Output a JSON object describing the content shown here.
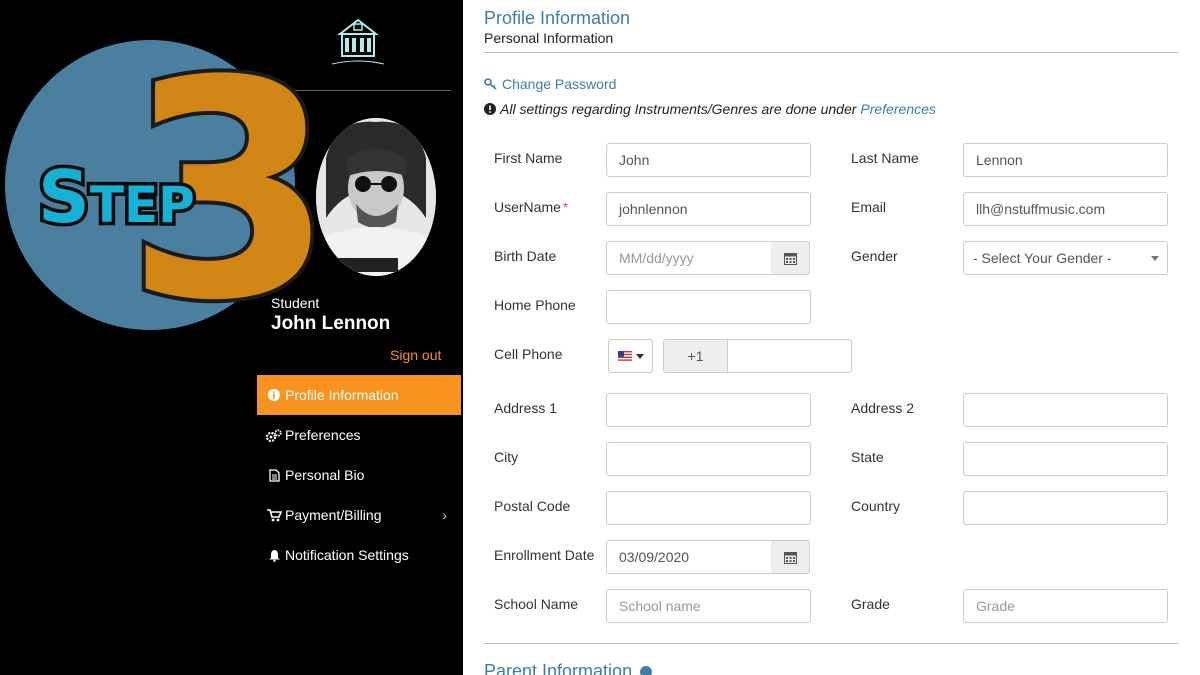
{
  "sidebar": {
    "role": "Student",
    "user_name": "John Lennon",
    "signout_label": "Sign out",
    "nav_items": [
      {
        "label": "Profile Information",
        "icon": "info-circle-icon",
        "active": true
      },
      {
        "label": "Preferences",
        "icon": "gears-icon",
        "active": false
      },
      {
        "label": "Personal Bio",
        "icon": "document-icon",
        "active": false
      },
      {
        "label": "Payment/Billing",
        "icon": "cart-icon",
        "active": false,
        "has_submenu": true
      },
      {
        "label": "Notification Settings",
        "icon": "bell-icon",
        "active": false
      }
    ]
  },
  "overlay": {
    "step_word": "Step",
    "step_number": "3"
  },
  "main": {
    "title": "Profile Information",
    "subtitle": "Personal Information",
    "change_password": "Change Password",
    "note_text": "All settings regarding Instruments/Genres are done under",
    "note_link": "Preferences",
    "parent_title": "Parent Information"
  },
  "form": {
    "first_name": {
      "label": "First Name",
      "value": "John"
    },
    "last_name": {
      "label": "Last Name",
      "value": "Lennon"
    },
    "username": {
      "label": "UserName",
      "required": "*",
      "value": "johnlennon"
    },
    "email": {
      "label": "Email",
      "value": "llh@nstuffmusic.com"
    },
    "birth_date": {
      "label": "Birth Date",
      "placeholder": "MM/dd/yyyy"
    },
    "gender": {
      "label": "Gender",
      "selected": "- Select Your Gender -"
    },
    "home_phone": {
      "label": "Home Phone",
      "value": ""
    },
    "cell_phone": {
      "label": "Cell Phone",
      "dial_code": "+1",
      "value": ""
    },
    "address1": {
      "label": "Address 1",
      "value": ""
    },
    "address2": {
      "label": "Address 2",
      "value": ""
    },
    "city": {
      "label": "City",
      "value": ""
    },
    "state": {
      "label": "State",
      "value": ""
    },
    "postal_code": {
      "label": "Postal Code",
      "value": ""
    },
    "country": {
      "label": "Country",
      "value": ""
    },
    "enrollment_date": {
      "label": "Enrollment Date",
      "value": "03/09/2020"
    },
    "school_name": {
      "label": "School Name",
      "placeholder": "School name"
    },
    "grade": {
      "label": "Grade",
      "placeholder": "Grade"
    }
  },
  "colors": {
    "accent": "#f7931e",
    "link": "#3d7ea6",
    "step_circle": "#4a7fa0",
    "step_number": "#d18616",
    "step_text": "#18b1d6"
  }
}
